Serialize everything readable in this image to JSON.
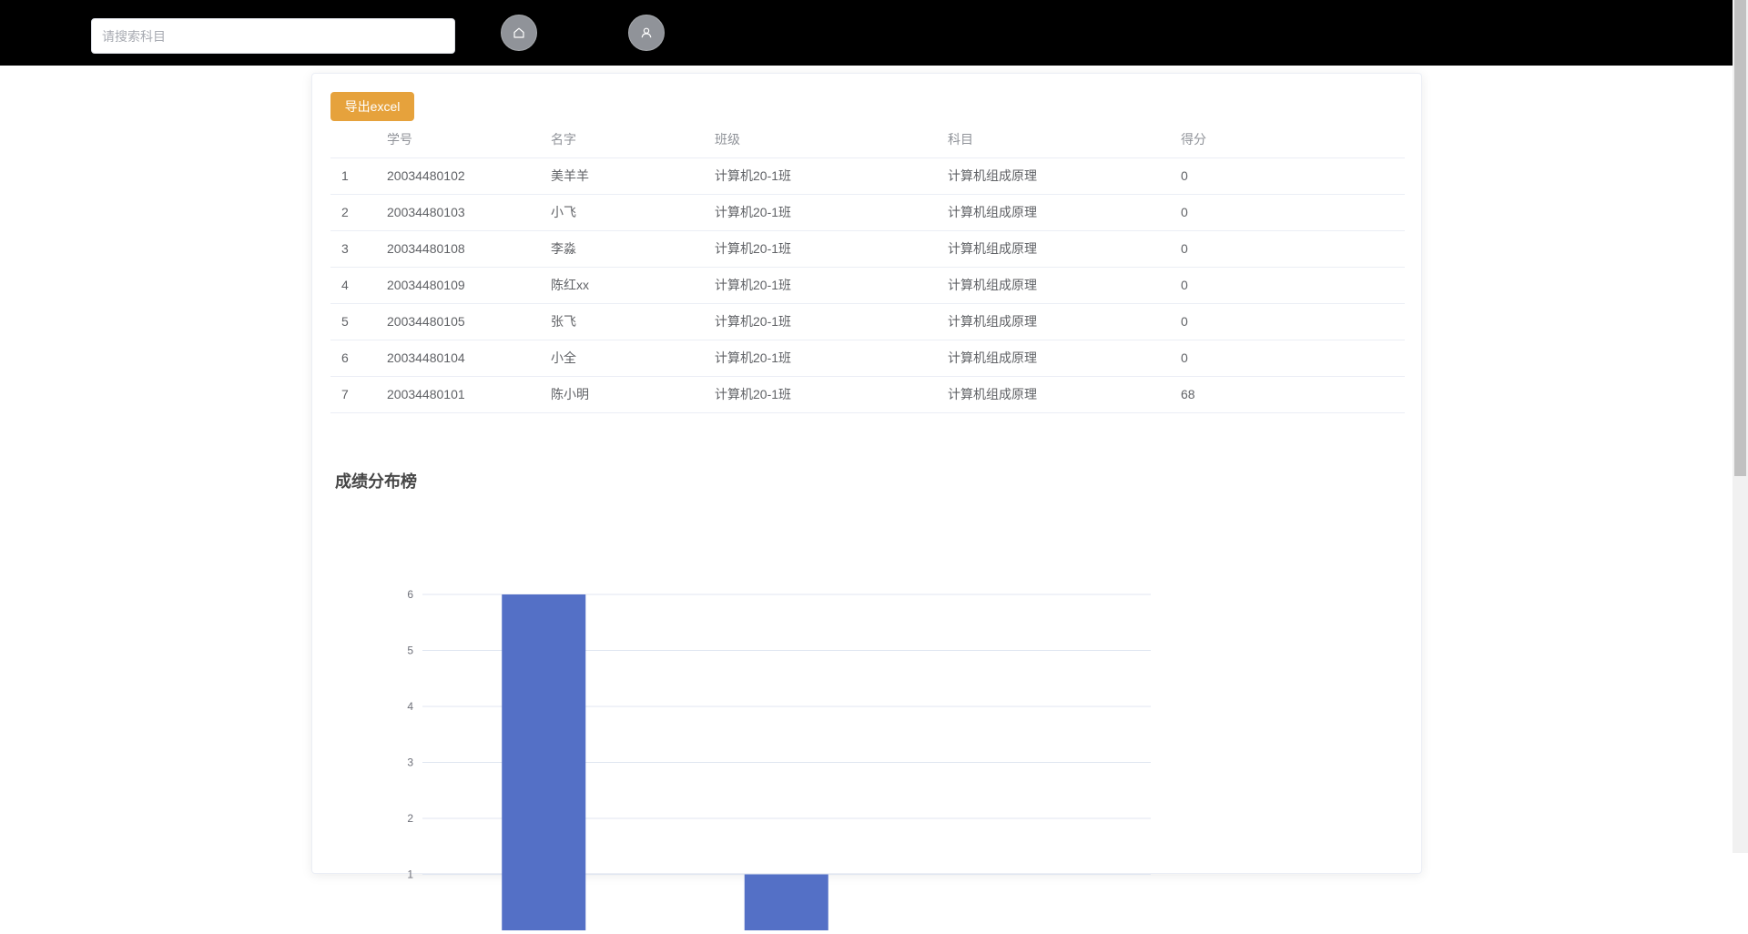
{
  "header": {
    "search_placeholder": "请搜索科目",
    "home_icon": "home-icon",
    "user_icon": "user-icon"
  },
  "toolbar": {
    "export_label": "导出excel"
  },
  "table": {
    "columns": [
      "",
      "学号",
      "名字",
      "班级",
      "科目",
      "得分"
    ],
    "rows": [
      [
        "1",
        "20034480102",
        "美羊羊",
        "计算机20-1班",
        "计算机组成原理",
        "0"
      ],
      [
        "2",
        "20034480103",
        "小飞",
        "计算机20-1班",
        "计算机组成原理",
        "0"
      ],
      [
        "3",
        "20034480108",
        "李淼",
        "计算机20-1班",
        "计算机组成原理",
        "0"
      ],
      [
        "4",
        "20034480109",
        "陈红xx",
        "计算机20-1班",
        "计算机组成原理",
        "0"
      ],
      [
        "5",
        "20034480105",
        "张飞",
        "计算机20-1班",
        "计算机组成原理",
        "0"
      ],
      [
        "6",
        "20034480104",
        "小全",
        "计算机20-1班",
        "计算机组成原理",
        "0"
      ],
      [
        "7",
        "20034480101",
        "陈小明",
        "计算机20-1班",
        "计算机组成原理",
        "68"
      ]
    ]
  },
  "colors": {
    "header_bg": "#000000",
    "export_button": "#e6a23c",
    "bar": "#5470c6",
    "grid": "#e0e6f1"
  },
  "chart_data": {
    "type": "bar",
    "title": "成绩分布榜",
    "series": [
      {
        "values": [
          6,
          1
        ]
      }
    ],
    "yticks": [
      "1",
      "2",
      "3",
      "4",
      "5",
      "6"
    ],
    "ylim": [
      0,
      6
    ],
    "grid": true
  }
}
